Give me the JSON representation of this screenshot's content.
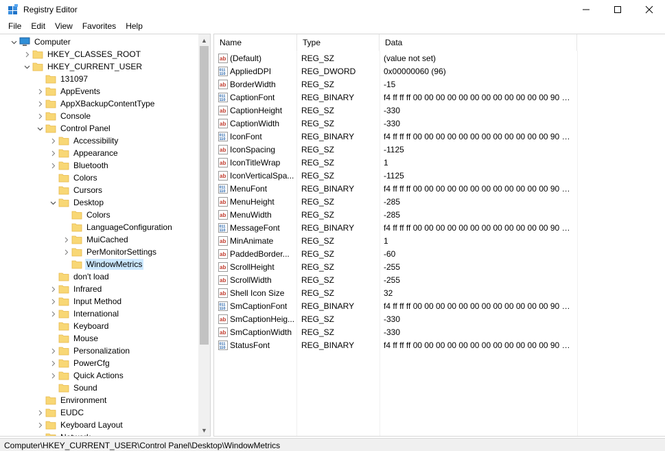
{
  "window": {
    "title": "Registry Editor",
    "minimize_icon": "minimize-icon",
    "maximize_icon": "maximize-icon",
    "close_icon": "close-icon"
  },
  "menu": [
    "File",
    "Edit",
    "View",
    "Favorites",
    "Help"
  ],
  "tree": [
    {
      "label": "Computer",
      "level": 0,
      "expander": "expanded",
      "icon": "computer-icon"
    },
    {
      "label": "HKEY_CLASSES_ROOT",
      "level": 1,
      "expander": "collapsed"
    },
    {
      "label": "HKEY_CURRENT_USER",
      "level": 1,
      "expander": "expanded"
    },
    {
      "label": "131097",
      "level": 2,
      "expander": "none"
    },
    {
      "label": "AppEvents",
      "level": 2,
      "expander": "collapsed"
    },
    {
      "label": "AppXBackupContentType",
      "level": 2,
      "expander": "collapsed"
    },
    {
      "label": "Console",
      "level": 2,
      "expander": "collapsed"
    },
    {
      "label": "Control Panel",
      "level": 2,
      "expander": "expanded"
    },
    {
      "label": "Accessibility",
      "level": 3,
      "expander": "collapsed"
    },
    {
      "label": "Appearance",
      "level": 3,
      "expander": "collapsed"
    },
    {
      "label": "Bluetooth",
      "level": 3,
      "expander": "collapsed"
    },
    {
      "label": "Colors",
      "level": 3,
      "expander": "none"
    },
    {
      "label": "Cursors",
      "level": 3,
      "expander": "none"
    },
    {
      "label": "Desktop",
      "level": 3,
      "expander": "expanded"
    },
    {
      "label": "Colors",
      "level": 4,
      "expander": "none"
    },
    {
      "label": "LanguageConfiguration",
      "level": 4,
      "expander": "none"
    },
    {
      "label": "MuiCached",
      "level": 4,
      "expander": "collapsed"
    },
    {
      "label": "PerMonitorSettings",
      "level": 4,
      "expander": "collapsed"
    },
    {
      "label": "WindowMetrics",
      "level": 4,
      "expander": "none",
      "selected": true
    },
    {
      "label": "don't load",
      "level": 3,
      "expander": "none"
    },
    {
      "label": "Infrared",
      "level": 3,
      "expander": "collapsed"
    },
    {
      "label": "Input Method",
      "level": 3,
      "expander": "collapsed"
    },
    {
      "label": "International",
      "level": 3,
      "expander": "collapsed"
    },
    {
      "label": "Keyboard",
      "level": 3,
      "expander": "none"
    },
    {
      "label": "Mouse",
      "level": 3,
      "expander": "none"
    },
    {
      "label": "Personalization",
      "level": 3,
      "expander": "collapsed"
    },
    {
      "label": "PowerCfg",
      "level": 3,
      "expander": "collapsed"
    },
    {
      "label": "Quick Actions",
      "level": 3,
      "expander": "collapsed"
    },
    {
      "label": "Sound",
      "level": 3,
      "expander": "none"
    },
    {
      "label": "Environment",
      "level": 2,
      "expander": "none"
    },
    {
      "label": "EUDC",
      "level": 2,
      "expander": "collapsed"
    },
    {
      "label": "Keyboard Layout",
      "level": 2,
      "expander": "collapsed"
    },
    {
      "label": "Network",
      "level": 2,
      "expander": "none"
    }
  ],
  "columns": {
    "name": "Name",
    "type": "Type",
    "data": "Data"
  },
  "values": [
    {
      "icon": "string-value-icon",
      "name": "(Default)",
      "type": "REG_SZ",
      "data": "(value not set)"
    },
    {
      "icon": "binary-value-icon",
      "name": "AppliedDPI",
      "type": "REG_DWORD",
      "data": "0x00000060 (96)"
    },
    {
      "icon": "string-value-icon",
      "name": "BorderWidth",
      "type": "REG_SZ",
      "data": "-15"
    },
    {
      "icon": "binary-value-icon",
      "name": "CaptionFont",
      "type": "REG_BINARY",
      "data": "f4 ff ff ff 00 00 00 00 00 00 00 00 00 00 00 00 90 01 0..."
    },
    {
      "icon": "string-value-icon",
      "name": "CaptionHeight",
      "type": "REG_SZ",
      "data": "-330"
    },
    {
      "icon": "string-value-icon",
      "name": "CaptionWidth",
      "type": "REG_SZ",
      "data": "-330"
    },
    {
      "icon": "binary-value-icon",
      "name": "IconFont",
      "type": "REG_BINARY",
      "data": "f4 ff ff ff 00 00 00 00 00 00 00 00 00 00 00 00 90 01 0..."
    },
    {
      "icon": "string-value-icon",
      "name": "IconSpacing",
      "type": "REG_SZ",
      "data": "-1125"
    },
    {
      "icon": "string-value-icon",
      "name": "IconTitleWrap",
      "type": "REG_SZ",
      "data": "1"
    },
    {
      "icon": "string-value-icon",
      "name": "IconVerticalSpa...",
      "type": "REG_SZ",
      "data": "-1125"
    },
    {
      "icon": "binary-value-icon",
      "name": "MenuFont",
      "type": "REG_BINARY",
      "data": "f4 ff ff ff 00 00 00 00 00 00 00 00 00 00 00 00 90 01 0..."
    },
    {
      "icon": "string-value-icon",
      "name": "MenuHeight",
      "type": "REG_SZ",
      "data": "-285"
    },
    {
      "icon": "string-value-icon",
      "name": "MenuWidth",
      "type": "REG_SZ",
      "data": "-285"
    },
    {
      "icon": "binary-value-icon",
      "name": "MessageFont",
      "type": "REG_BINARY",
      "data": "f4 ff ff ff 00 00 00 00 00 00 00 00 00 00 00 00 90 01 0..."
    },
    {
      "icon": "string-value-icon",
      "name": "MinAnimate",
      "type": "REG_SZ",
      "data": "1"
    },
    {
      "icon": "string-value-icon",
      "name": "PaddedBorder...",
      "type": "REG_SZ",
      "data": "-60"
    },
    {
      "icon": "string-value-icon",
      "name": "ScrollHeight",
      "type": "REG_SZ",
      "data": "-255"
    },
    {
      "icon": "string-value-icon",
      "name": "ScrollWidth",
      "type": "REG_SZ",
      "data": "-255"
    },
    {
      "icon": "string-value-icon",
      "name": "Shell Icon Size",
      "type": "REG_SZ",
      "data": "32"
    },
    {
      "icon": "binary-value-icon",
      "name": "SmCaptionFont",
      "type": "REG_BINARY",
      "data": "f4 ff ff ff 00 00 00 00 00 00 00 00 00 00 00 00 90 01 0..."
    },
    {
      "icon": "string-value-icon",
      "name": "SmCaptionHeig...",
      "type": "REG_SZ",
      "data": "-330"
    },
    {
      "icon": "string-value-icon",
      "name": "SmCaptionWidth",
      "type": "REG_SZ",
      "data": "-330"
    },
    {
      "icon": "binary-value-icon",
      "name": "StatusFont",
      "type": "REG_BINARY",
      "data": "f4 ff ff ff 00 00 00 00 00 00 00 00 00 00 00 00 90 01 0..."
    }
  ],
  "status": {
    "path": "Computer\\HKEY_CURRENT_USER\\Control Panel\\Desktop\\WindowMetrics"
  },
  "colors": {
    "selection": "#cce8ff",
    "folder": "#f8d775",
    "folder_dark": "#e6b84a",
    "string_icon": "#c0392b",
    "binary_icon": "#1f5fa8"
  }
}
